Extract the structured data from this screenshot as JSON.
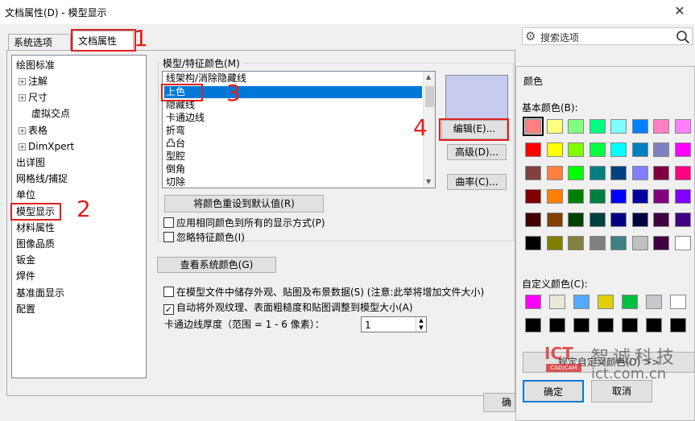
{
  "window": {
    "title": "文档属性(D) - 模型显示",
    "close": "✕"
  },
  "tabs": [
    {
      "label": "系统选项(S)"
    },
    {
      "label": "文档属性(D)"
    }
  ],
  "search": {
    "placeholder": "搜索选项"
  },
  "tree": {
    "items": [
      {
        "label": "绘图标准"
      },
      {
        "label": "注解"
      },
      {
        "label": "尺寸"
      },
      {
        "label": "虚拟交点"
      },
      {
        "label": "表格"
      },
      {
        "label": "DimXpert"
      },
      {
        "label": "出详图"
      },
      {
        "label": "网格线/捕捉"
      },
      {
        "label": "单位"
      },
      {
        "label": "模型显示"
      },
      {
        "label": "材料属性"
      },
      {
        "label": "图像品质"
      },
      {
        "label": "钣金"
      },
      {
        "label": "焊件"
      },
      {
        "label": "基准面显示"
      },
      {
        "label": "配置"
      }
    ]
  },
  "group": {
    "label": "模型/特征颜色(M)"
  },
  "colorlist": {
    "items": [
      "线架构/消除隐藏线",
      "上色",
      "隐藏线",
      "卡通边线",
      "折弯",
      "凸台",
      "型腔",
      "倒角",
      "切除"
    ]
  },
  "buttons": {
    "edit": "编辑(E)...",
    "advanced": "高级(D)...",
    "curvature": "曲率(C)...",
    "reset": "将颜色重设到默认值(R)",
    "view_system": "查看系统颜色(G)",
    "ok_partial": "确"
  },
  "checks": {
    "apply_all": "应用相同颜色到所有的显示方式(P)",
    "ignore": "忽略特征颜色(I)",
    "store": "在模型文件中储存外观、贴图及布景数据(S) (注意:此举将增加文件大小)",
    "auto_scale": "自动将外观纹理、表面粗糙度和贴图调整到模型大小(A)"
  },
  "edge": {
    "label": "卡通边线厚度（范围 = 1 - 6 像素）：",
    "value": "1"
  },
  "annotations": [
    "1",
    "2",
    "3",
    "4"
  ],
  "color_dialog": {
    "title": "颜色",
    "basic_label": "基本颜色(B):",
    "custom_label": "自定义颜色(C):",
    "define_btn": "规定自定义颜色(D) >>",
    "ok": "确定",
    "cancel": "取消",
    "basic_colors": [
      "#ff8080",
      "#ffff80",
      "#80ff80",
      "#00ff80",
      "#80ffff",
      "#0080ff",
      "#ff80c0",
      "#ff80ff",
      "#ff0000",
      "#ffff00",
      "#80ff00",
      "#00ff40",
      "#00ffff",
      "#0080c0",
      "#8080c0",
      "#ff00ff",
      "#804040",
      "#ff8040",
      "#00ff00",
      "#008080",
      "#004080",
      "#8080ff",
      "#800040",
      "#ff0080",
      "#800000",
      "#ff8000",
      "#008000",
      "#008040",
      "#0000ff",
      "#0000a0",
      "#800080",
      "#8000ff",
      "#400000",
      "#804000",
      "#004000",
      "#004040",
      "#000080",
      "#000040",
      "#400040",
      "#400080",
      "#000000",
      "#808000",
      "#808040",
      "#808080",
      "#408080",
      "#c0c0c0",
      "#400040",
      "#ffffff"
    ],
    "custom_colors": [
      "#ff00ff",
      "#e8e8dc",
      "#55aaff",
      "#e0d000",
      "#00c040",
      "#c8c8cc",
      "#ffffff",
      "#000000",
      "#000000",
      "#000000",
      "#000000",
      "#000000",
      "#000000",
      "#000000"
    ]
  },
  "watermark": {
    "logo": "ICT",
    "sub": "CAD/CAM",
    "brand": "智诚科技",
    "url": "ict.com.cn"
  },
  "colors": {
    "selection": "#0078d7",
    "annotation": "#e0201c",
    "swatch": "#c8cbf0"
  }
}
